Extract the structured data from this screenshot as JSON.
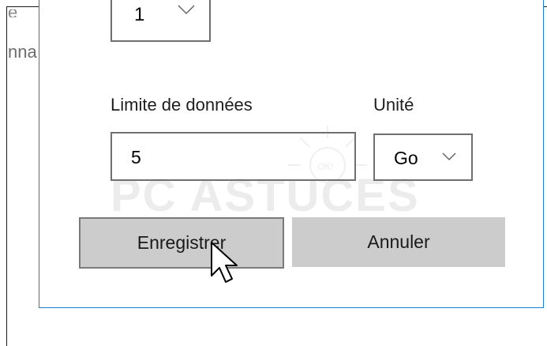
{
  "background_labels": {
    "top": "e",
    "side": "nna"
  },
  "dialog": {
    "number_select": {
      "value": "1",
      "chevron": "chevron-down-icon"
    },
    "data_limit": {
      "label": "Limite de données",
      "value": "5"
    },
    "unit": {
      "label": "Unité",
      "value": "Go",
      "chevron": "chevron-down-icon"
    },
    "buttons": {
      "save": "Enregistrer",
      "cancel": "Annuler"
    }
  },
  "watermark": {
    "text": "PC ASTUCES",
    "badge": "OK!"
  },
  "colors": {
    "dialog_border": "#1a7fd1",
    "button_bg": "#cccccc"
  }
}
